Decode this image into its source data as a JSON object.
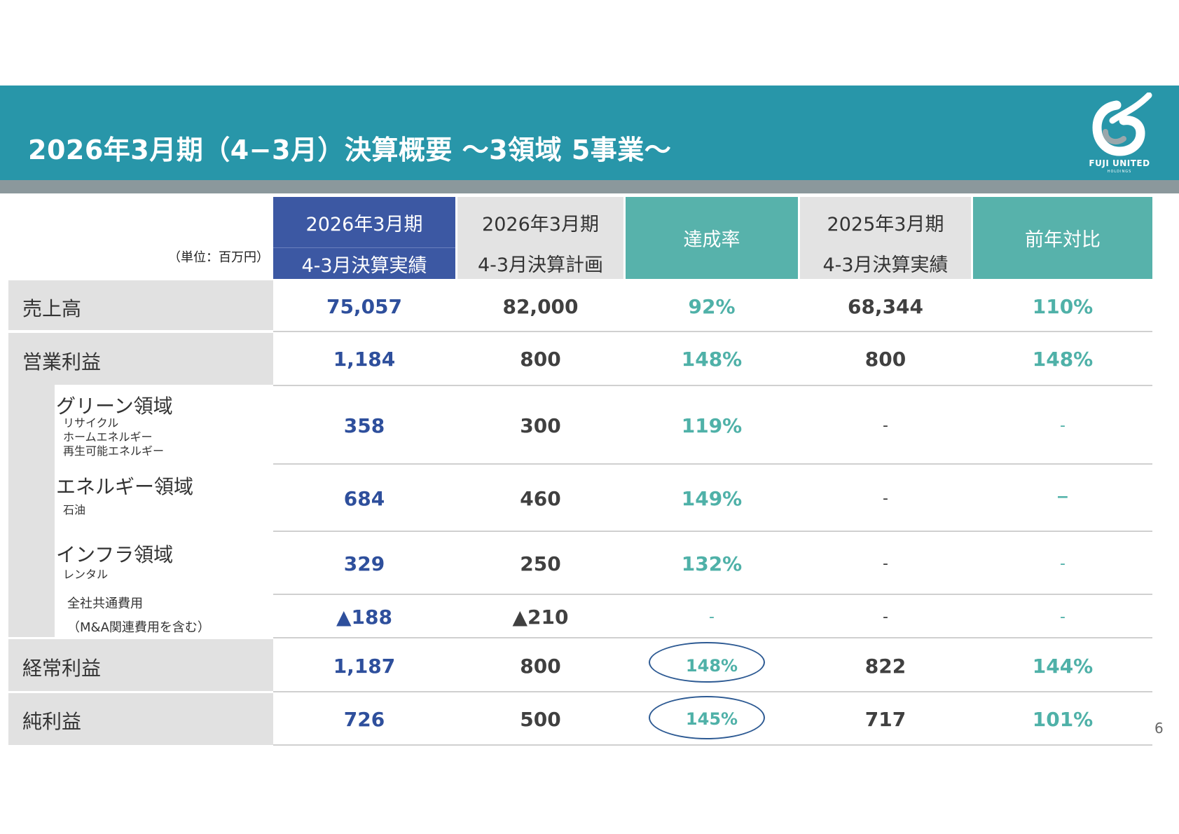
{
  "header": {
    "title": "2026年3月期（4−3月）決算概要 ～3領域 5事業～",
    "logo_text": "FUJI UNITED",
    "logo_sub": "HOLDINGS"
  },
  "table": {
    "unit": "（単位：百万円）",
    "columns": [
      {
        "line1": "2026年3月期",
        "line2": "4-3月決算実績"
      },
      {
        "line1": "2026年3月期",
        "line2": "4-3月決算計画"
      },
      {
        "line1": "達成率",
        "line2": ""
      },
      {
        "line1": "2025年3月期",
        "line2": "4-3月決算実績"
      },
      {
        "line1": "前年対比",
        "line2": ""
      }
    ],
    "rows": {
      "sales": {
        "label": "売上高",
        "values": [
          "75,057",
          "82,000",
          "92%",
          "68,344",
          "110%"
        ]
      },
      "op": {
        "label": "営業利益",
        "values": [
          "1,184",
          "800",
          "148%",
          "800",
          "148%"
        ]
      },
      "green": {
        "label": "グリーン領域",
        "sub": [
          "リサイクル",
          "ホームエネルギー",
          "再生可能エネルギー"
        ],
        "values": [
          "358",
          "300",
          "119%",
          "-",
          "-"
        ]
      },
      "energy": {
        "label": "エネルギー領域",
        "sub": [
          "石油"
        ],
        "values": [
          "684",
          "460",
          "149%",
          "-",
          "−"
        ]
      },
      "infra": {
        "label": "インフラ領域",
        "sub": [
          "レンタル"
        ],
        "values": [
          "329",
          "250",
          "132%",
          "-",
          "-"
        ]
      },
      "common": {
        "label1": "全社共通費用",
        "label2": "（M&A関連費用を含む）",
        "values": [
          "▲188",
          "▲210",
          "-",
          "-",
          "-"
        ]
      },
      "ordinary": {
        "label": "経常利益",
        "values": [
          "1,187",
          "800",
          "148%",
          "822",
          "144%"
        ]
      },
      "net": {
        "label": "純利益",
        "values": [
          "726",
          "500",
          "145%",
          "717",
          "101%"
        ]
      }
    }
  },
  "colors": {
    "banner": "#2896a9",
    "actual_header": "#3c58a3",
    "teal_header": "#57b2ab",
    "gray_header": "#e3e3e3",
    "blue_value": "#2e4f9c",
    "teal_value": "#4fb1a8"
  },
  "page_number": "6"
}
